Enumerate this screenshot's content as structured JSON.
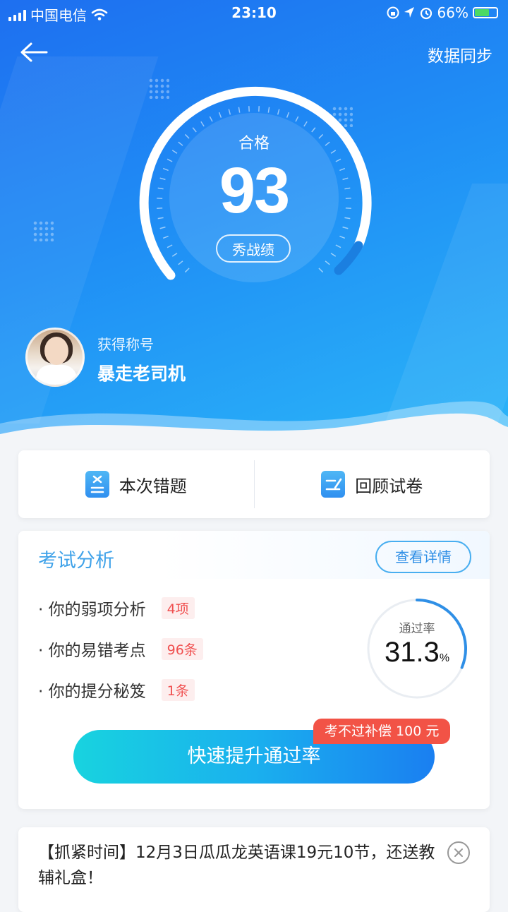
{
  "status_bar": {
    "carrier": "中国电信",
    "time": "23:10",
    "battery": "66%",
    "battery_level": 0.66
  },
  "header": {
    "sync_label": "数据同步"
  },
  "score": {
    "status": "合格",
    "value": "93",
    "share_label": "秀战绩"
  },
  "user": {
    "title_label": "获得称号",
    "title_name": "暴走老司机"
  },
  "actions": {
    "mistakes_label": "本次错题",
    "review_label": "回顾试卷"
  },
  "analysis": {
    "title": "考试分析",
    "detail_label": "查看详情",
    "rows": [
      {
        "label": "· 你的弱项分析",
        "tag": "4项"
      },
      {
        "label": "· 你的易错考点",
        "tag": "96条"
      },
      {
        "label": "· 你的提分秘笈",
        "tag": "1条"
      }
    ],
    "pass_rate_label": "通过率",
    "pass_rate_value": "31.3",
    "pass_rate_unit": "%",
    "pass_rate": 0.313,
    "cta_label": "快速提升通过率",
    "badge": "考不过补偿 100 元"
  },
  "notice": {
    "text": "【抓紧时间】12月3日瓜瓜龙英语课19元10节，还送教辅礼盒！"
  },
  "colors": {
    "primary": "#1f8ef5",
    "accent": "#3fa2e9",
    "tag_red": "#f05050",
    "badge_red": "#f25346"
  }
}
